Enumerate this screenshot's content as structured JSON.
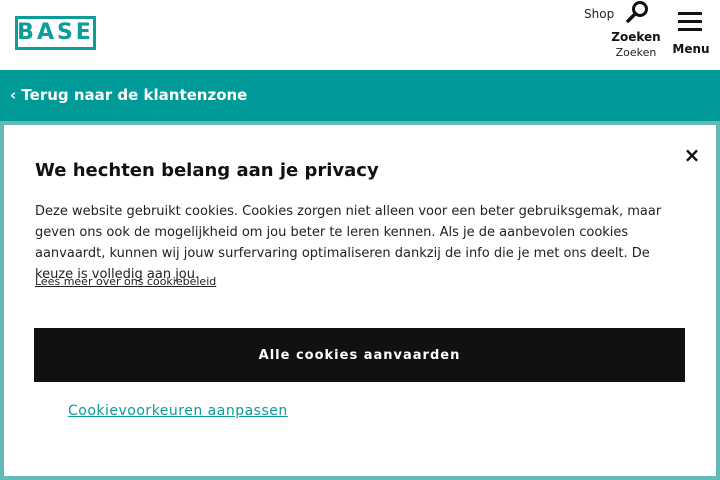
{
  "header": {
    "logo_text": "BASE",
    "shop_label": "Shop",
    "search_label": "Zoeken",
    "search_sublabel": "Zoeken",
    "menu_label": "Menu"
  },
  "nav": {
    "back_link": "‹ Terug naar de klantenzone"
  },
  "cookie_modal": {
    "title": "We hechten belang aan je privacy",
    "body": "Deze website gebruikt cookies. Cookies zorgen niet alleen voor een beter gebruiksgemak, maar geven ons ook de mogelijkheid om jou beter te leren kennen. Als je de aanbevolen cookies aanvaardt, kunnen wij jouw surfervaring optimaliseren dankzij de info die je met ons deelt. De keuze is volledig aan jou.",
    "policy_link": "Lees meer over ons cookiebeleid",
    "accept_button": "Alle cookies aanvaarden",
    "preferences_link": "Cookievoorkeuren aanpassen",
    "close_icon": "×"
  },
  "colors": {
    "brand_teal": "#009a98",
    "modal_border": "#62b9b5",
    "button_black": "#111111"
  },
  "icons": {
    "search": "search-icon",
    "menu": "hamburger-icon",
    "close": "close-icon"
  }
}
